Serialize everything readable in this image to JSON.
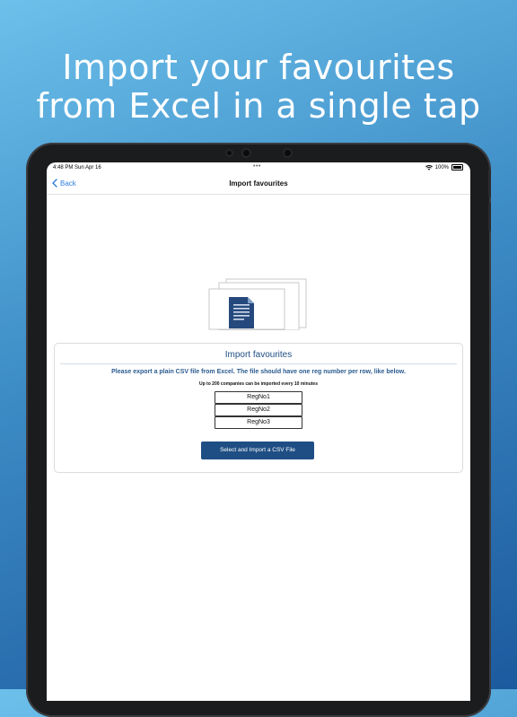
{
  "headline": {
    "line1": "Import your favourites",
    "line2": "from Excel in a single tap"
  },
  "statusbar": {
    "time": "4:48 PM  Sun Apr 16",
    "dots": "•••",
    "wifi_icon": "wifi-icon",
    "battery_percent": "100%",
    "battery_icon": "battery-icon"
  },
  "nav": {
    "back_label": "Back",
    "back_icon": "chevron-left-icon",
    "title": "Import favourites"
  },
  "illustration": {
    "icon": "document-stack-icon"
  },
  "card": {
    "title": "Import favourites",
    "description": "Please export a plain CSV file from Excel. The file should have one reg number per row, like below.",
    "note": "Up to 200 companies can be imported every 10 minutes",
    "examples": [
      "RegNo1",
      "RegNo2",
      "RegNo3"
    ],
    "import_button": "Select and Import a CSV File"
  },
  "colors": {
    "accent": "#1f4e84",
    "link": "#2f7de1",
    "background_top": "#6cc0ea",
    "background_bottom": "#1c5a9e"
  }
}
